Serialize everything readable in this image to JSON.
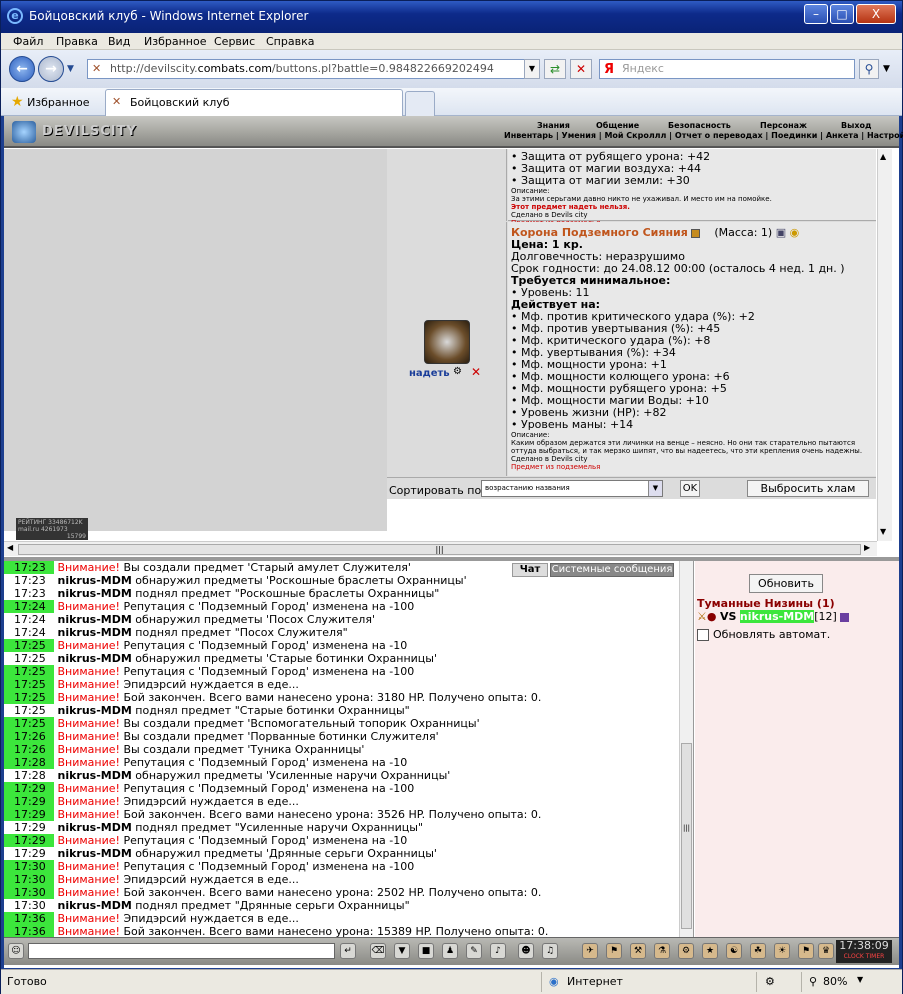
{
  "window": {
    "title": "Бойцовский клуб - Windows Internet Explorer",
    "minimize": "–",
    "maximize": "□",
    "close": "X"
  },
  "menu": [
    "Файл",
    "Правка",
    "Вид",
    "Избранное",
    "Сервис",
    "Справка"
  ],
  "address": {
    "url_prefix": "http://devilscity.",
    "url_domain": "combats.com",
    "url_suffix": "/buttons.pl?battle=0.984822669202494",
    "search_placeholder": "Яндекс",
    "search_engine_letter": "Я"
  },
  "favorites": {
    "label": "Избранное",
    "tab_label": "Бойцовский клуб"
  },
  "game": {
    "logo": "DEVILSCITY",
    "top_menu": [
      "Знания",
      "Общение",
      "Безопасность",
      "Персонаж",
      "Выход"
    ],
    "sub_menu": "Инвентарь | Умения | Мой Скроллл | Отчет о переводах | Поединки | Анкета | Настройки"
  },
  "item_prev": {
    "lines": [
      "• Защита от рубящего урона: +42",
      "• Защита от магии воздуха: +44",
      "• Защита от магии земли: +30"
    ],
    "desc_label": "Описание:",
    "desc": "За этими серьгами давно никто не ухаживал. И место им на помойке.",
    "cannot_wear": "Этот предмет надеть нельзя.",
    "made_in": "Сделано в Devils city",
    "from_dungeon": "Предмет из подземелья"
  },
  "item": {
    "name": "Корона Подземного Сияния",
    "mass": "(Масса: 1)",
    "wear_label": "надеть",
    "price": "Цена: 1 кр.",
    "durability": "Долговечность: неразрушимо",
    "expiry": "Срок годности: до 24.08.12 00:00 (осталось 4 нед. 1 дн. )",
    "req_title": "Требуется минимальное:",
    "req": "• Уровень: 11",
    "acts_title": "Действует на:",
    "acts": [
      "• Мф. против критического удара (%): +2",
      "• Мф. против увертывания (%): +45",
      "• Мф. критического удара (%): +8",
      "• Мф. увертывания (%): +34",
      "• Мф. мощности урона: +1",
      "• Мф. мощности колющего урона: +6",
      "• Мф. мощности рубящего урона: +5",
      "• Мф. мощности магии Воды: +10",
      "• Уровень жизни (HP): +82",
      "• Уровень маны: +14"
    ],
    "desc_label": "Описание:",
    "desc": "Каким образом держатся эти личинки на венце – неясно. Но они так старательно пытаются оттуда выбраться, и так мерзко шипят, что вы надеетесь, что эти крепления очень надежны.",
    "made_in": "Сделано в Devils city",
    "from_dungeon": "Предмет из подземелья"
  },
  "sort": {
    "label": "Сортировать по",
    "value": "возрастанию названия",
    "ok": "OK",
    "junk": "Выбросить хлам"
  },
  "counters": {
    "line1": "РЕЙТИНГ 33486712K",
    "line2": "mail.ru 4261973",
    "line3": "15799"
  },
  "chat_tabs": {
    "chat": "Чат",
    "system": "Системные сообщения"
  },
  "chat": [
    {
      "t": "17:23",
      "hl": true,
      "w": true,
      "b": "",
      "s": "Вы создали предмет 'Старый амулет Служителя'"
    },
    {
      "t": "17:23",
      "hl": false,
      "w": false,
      "b": "nikrus-MDM",
      "s": " обнаружил предметы 'Роскошные браслеты Охранницы'"
    },
    {
      "t": "17:23",
      "hl": false,
      "w": false,
      "b": "nikrus-MDM",
      "s": " поднял предмет \"Роскошные браслеты Охранницы\""
    },
    {
      "t": "17:24",
      "hl": true,
      "w": true,
      "b": "",
      "s": "Репутация с 'Подземный Город' изменена на -100"
    },
    {
      "t": "17:24",
      "hl": false,
      "w": false,
      "b": "nikrus-MDM",
      "s": " обнаружил предметы 'Посох Служителя'"
    },
    {
      "t": "17:24",
      "hl": false,
      "w": false,
      "b": "nikrus-MDM",
      "s": " поднял предмет \"Посох Служителя\""
    },
    {
      "t": "17:25",
      "hl": true,
      "w": true,
      "b": "",
      "s": "Репутация с 'Подземный Город' изменена на -10"
    },
    {
      "t": "17:25",
      "hl": false,
      "w": false,
      "b": "nikrus-MDM",
      "s": " обнаружил предметы 'Старые ботинки Охранницы'"
    },
    {
      "t": "17:25",
      "hl": true,
      "w": true,
      "b": "",
      "s": "Репутация с 'Подземный Город' изменена на -100"
    },
    {
      "t": "17:25",
      "hl": true,
      "w": true,
      "b": "",
      "s": "Эпидэрсий нуждается в еде..."
    },
    {
      "t": "17:25",
      "hl": true,
      "w": true,
      "b": "",
      "s": "Бой закончен. Всего вами нанесено урона: 3180 HP. Получено опыта: 0."
    },
    {
      "t": "17:25",
      "hl": false,
      "w": false,
      "b": "nikrus-MDM",
      "s": " поднял предмет \"Старые ботинки Охранницы\""
    },
    {
      "t": "17:25",
      "hl": true,
      "w": true,
      "b": "",
      "s": "Вы создали предмет 'Вспомогательный топорик Охранницы'"
    },
    {
      "t": "17:26",
      "hl": true,
      "w": true,
      "b": "",
      "s": "Вы создали предмет 'Порванные ботинки Служителя'"
    },
    {
      "t": "17:26",
      "hl": true,
      "w": true,
      "b": "",
      "s": "Вы создали предмет 'Туника Охранницы'"
    },
    {
      "t": "17:28",
      "hl": true,
      "w": true,
      "b": "",
      "s": "Репутация с 'Подземный Город' изменена на -10"
    },
    {
      "t": "17:28",
      "hl": false,
      "w": false,
      "b": "nikrus-MDM",
      "s": " обнаружил предметы 'Усиленные наручи Охранницы'"
    },
    {
      "t": "17:29",
      "hl": true,
      "w": true,
      "b": "",
      "s": "Репутация с 'Подземный Город' изменена на -100"
    },
    {
      "t": "17:29",
      "hl": true,
      "w": true,
      "b": "",
      "s": "Эпидэрсий нуждается в еде..."
    },
    {
      "t": "17:29",
      "hl": true,
      "w": true,
      "b": "",
      "s": "Бой закончен. Всего вами нанесено урона: 3526 HP. Получено опыта: 0."
    },
    {
      "t": "17:29",
      "hl": false,
      "w": false,
      "b": "nikrus-MDM",
      "s": " поднял предмет \"Усиленные наручи Охранницы\""
    },
    {
      "t": "17:29",
      "hl": true,
      "w": true,
      "b": "",
      "s": "Репутация с 'Подземный Город' изменена на -10"
    },
    {
      "t": "17:29",
      "hl": false,
      "w": false,
      "b": "nikrus-MDM",
      "s": " обнаружил предметы 'Дрянные серьги Охранницы'"
    },
    {
      "t": "17:30",
      "hl": true,
      "w": true,
      "b": "",
      "s": "Репутация с 'Подземный Город' изменена на -100"
    },
    {
      "t": "17:30",
      "hl": true,
      "w": true,
      "b": "",
      "s": "Эпидэрсий нуждается в еде..."
    },
    {
      "t": "17:30",
      "hl": true,
      "w": true,
      "b": "",
      "s": "Бой закончен. Всего вами нанесено урона: 2502 HP. Получено опыта: 0."
    },
    {
      "t": "17:30",
      "hl": false,
      "w": false,
      "b": "nikrus-MDM",
      "s": " поднял предмет \"Дрянные серьги Охранницы\""
    },
    {
      "t": "17:36",
      "hl": true,
      "w": true,
      "b": "",
      "s": "Эпидэрсий нуждается в еде..."
    },
    {
      "t": "17:36",
      "hl": true,
      "w": true,
      "b": "",
      "s": "Бой закончен. Всего вами нанесено урона: 15389 HP. Получено опыта: 0."
    }
  ],
  "warning_word": "Внимание!",
  "right_panel": {
    "refresh": "Обновить",
    "location": "Туманные Низины (1)",
    "vs": "VS",
    "user": "nikrus-MDM",
    "level": "[12]",
    "auto": "Обновлять автомат."
  },
  "clock": {
    "time": "17:38",
    "sec": "09",
    "label": "CLOCK TIMER"
  },
  "status": {
    "ready": "Готово",
    "zone": "Интернет",
    "zoom": "80%"
  },
  "colors": {
    "highlight": "#3ce63c",
    "warning": "#e00000",
    "location": "#8b0000",
    "item_name": "#c0551c"
  }
}
